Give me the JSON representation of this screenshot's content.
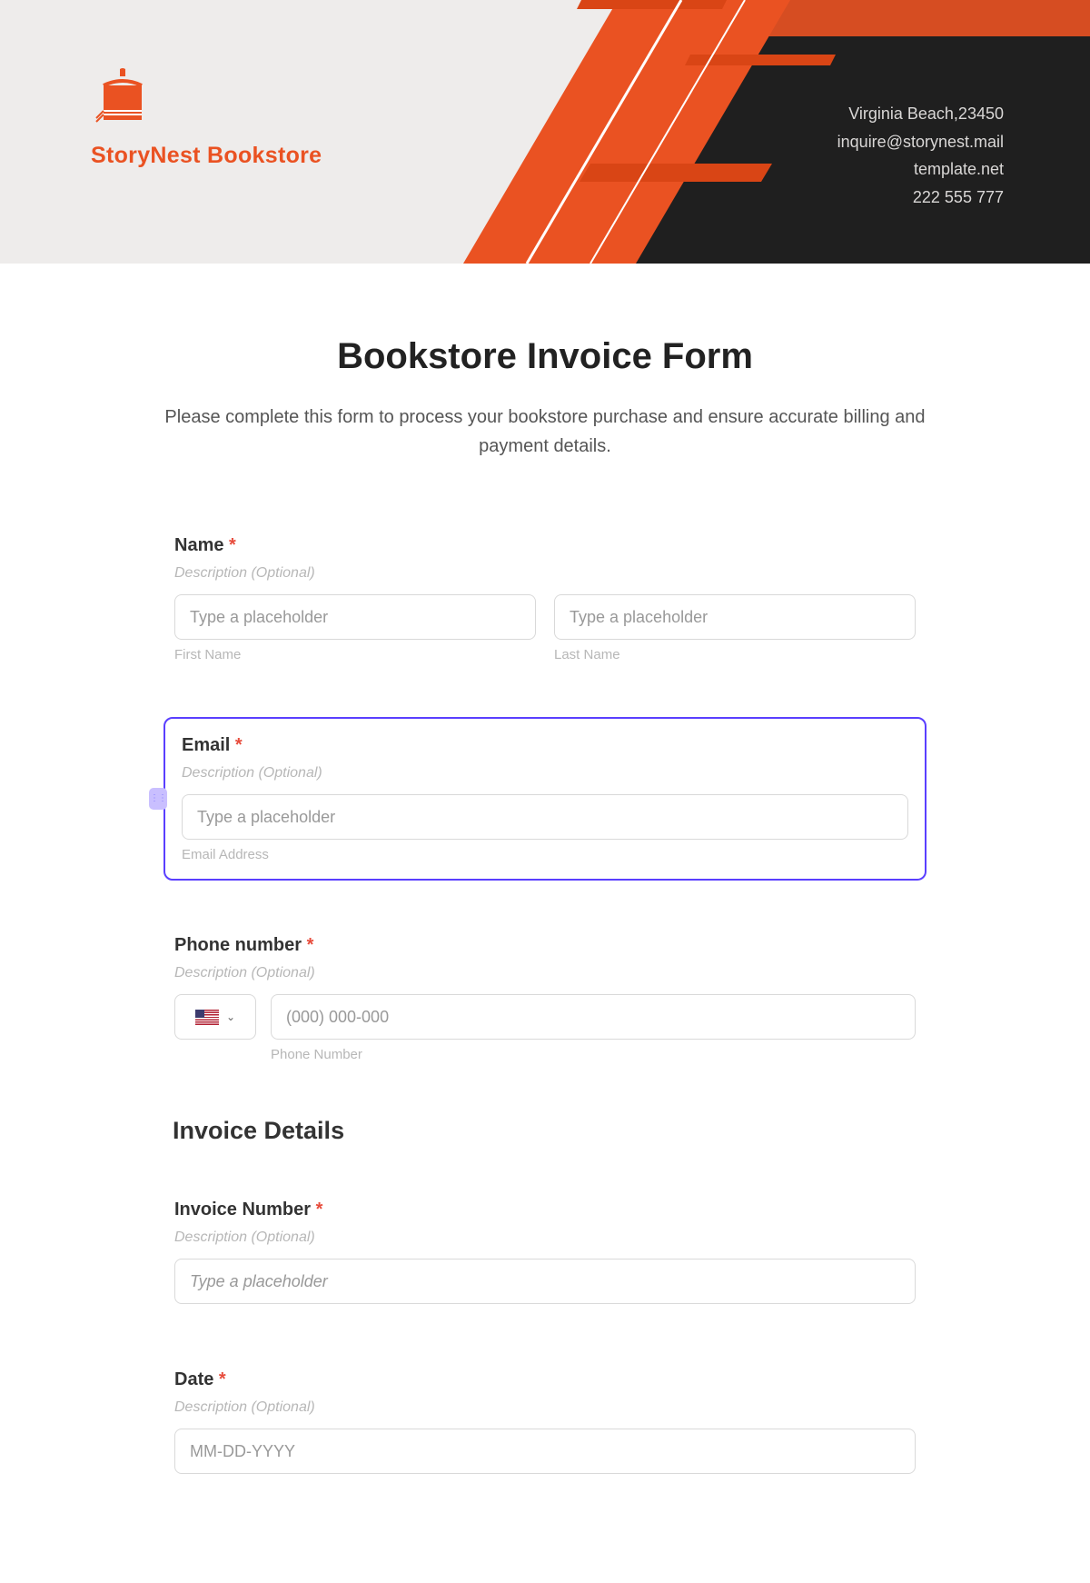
{
  "header": {
    "brand": "StoryNest Bookstore",
    "contact": {
      "address": "Virginia Beach,23450",
      "email": "inquire@storynest.mail",
      "site": "template.net",
      "phone": "222 555 777"
    }
  },
  "form": {
    "title": "Bookstore Invoice Form",
    "intro": "Please complete this form to process your bookstore purchase and ensure accurate billing and payment details.",
    "fields": {
      "name": {
        "label": "Name",
        "desc": "Description (Optional)",
        "first_placeholder": "Type a placeholder",
        "last_placeholder": "Type a placeholder",
        "first_sublabel": "First Name",
        "last_sublabel": "Last Name"
      },
      "email": {
        "label": "Email",
        "desc": "Description (Optional)",
        "placeholder": "Type a placeholder",
        "sublabel": "Email Address"
      },
      "phone": {
        "label": "Phone number",
        "desc": "Description (Optional)",
        "placeholder": "(000) 000-000",
        "sublabel": "Phone Number"
      },
      "invoice_section": "Invoice Details",
      "invoice_number": {
        "label": "Invoice Number",
        "desc": "Description (Optional)",
        "placeholder": "Type a placeholder"
      },
      "date": {
        "label": "Date",
        "desc": "Description (Optional)",
        "placeholder": "MM-DD-YYYY"
      }
    },
    "required_mark": "*"
  }
}
